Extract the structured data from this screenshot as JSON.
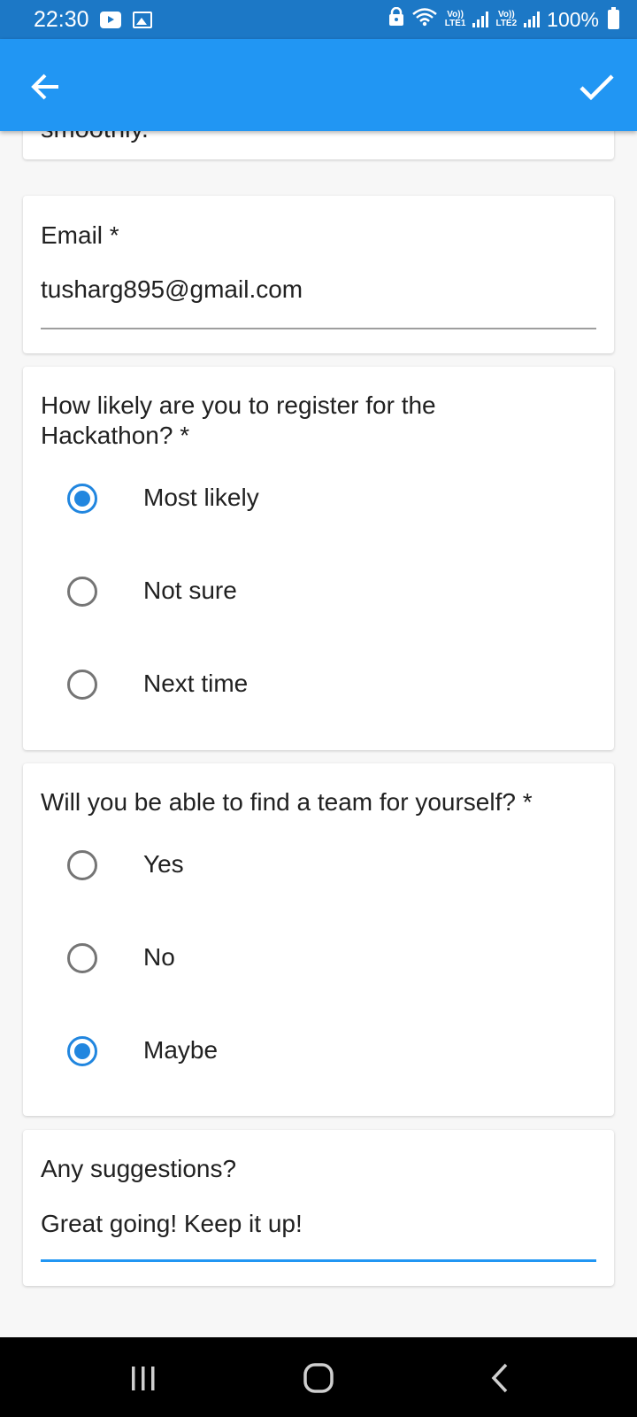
{
  "status_bar": {
    "time": "22:30",
    "battery": "100%",
    "sim1": {
      "top": "Vo))",
      "bottom": "LTE1"
    },
    "sim2": {
      "top": "Vo))",
      "bottom": "LTE2"
    },
    "icons": [
      "youtube-icon",
      "gallery-icon",
      "lock-icon",
      "wifi-icon",
      "signal-icon",
      "signal-icon",
      "battery-icon"
    ]
  },
  "app_bar": {
    "back_icon": "arrow-left-icon",
    "submit_icon": "checkmark-icon",
    "color": "#2196f3"
  },
  "form": {
    "previous_card_text": "smoothly.",
    "email": {
      "label": "Email *",
      "value": "tusharg895@gmail.com"
    },
    "register_question": {
      "label": "How likely are you to register for the Hackathon? *",
      "options": [
        {
          "label": "Most likely",
          "selected": true
        },
        {
          "label": "Not sure",
          "selected": false
        },
        {
          "label": "Next time",
          "selected": false
        }
      ]
    },
    "team_question": {
      "label": "Will you be able to find a team for yourself? *",
      "options": [
        {
          "label": "Yes",
          "selected": false
        },
        {
          "label": "No",
          "selected": false
        },
        {
          "label": "Maybe",
          "selected": true
        }
      ]
    },
    "suggestions": {
      "label": "Any suggestions?",
      "value": "Great going! Keep it up!"
    }
  },
  "nav_bar": {
    "icons": [
      "recent-apps-icon",
      "home-icon",
      "back-icon"
    ]
  },
  "colors": {
    "primary": "#2196f3",
    "status_bar": "#1c78c6",
    "radio_selected": "#2186df",
    "background": "#f7f7f7"
  }
}
